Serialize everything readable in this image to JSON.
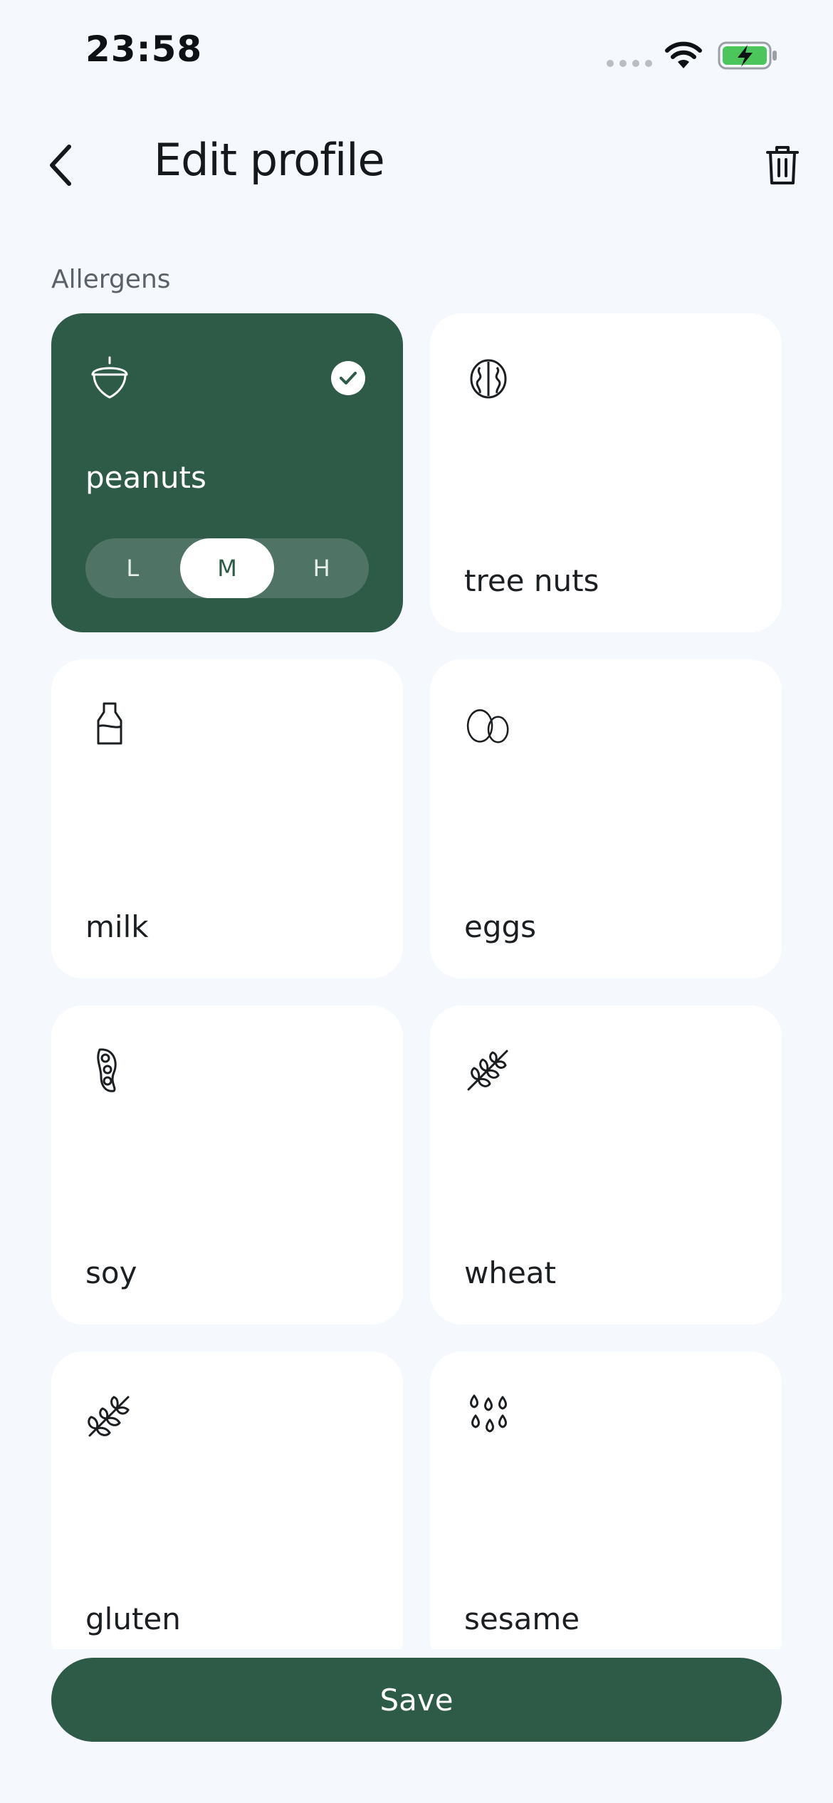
{
  "status_bar": {
    "time": "23:58"
  },
  "header": {
    "title": "Edit profile"
  },
  "section": {
    "label": "Allergens"
  },
  "allergens": [
    {
      "label": "peanuts",
      "icon": "acorn-icon",
      "selected": true,
      "levels": [
        "L",
        "M",
        "H"
      ],
      "active_level": "M"
    },
    {
      "label": "tree nuts",
      "icon": "walnut-icon",
      "selected": false
    },
    {
      "label": "milk",
      "icon": "milk-bottle-icon",
      "selected": false
    },
    {
      "label": "eggs",
      "icon": "eggs-icon",
      "selected": false
    },
    {
      "label": "soy",
      "icon": "soybean-icon",
      "selected": false
    },
    {
      "label": "wheat",
      "icon": "wheat-icon",
      "selected": false
    },
    {
      "label": "gluten",
      "icon": "grain-icon",
      "selected": false
    },
    {
      "label": "sesame",
      "icon": "sesame-seeds-icon",
      "selected": false
    }
  ],
  "actions": {
    "save_label": "Save"
  },
  "colors": {
    "accent": "#2e5a48",
    "background": "#f5f8fc",
    "card": "#ffffff"
  }
}
